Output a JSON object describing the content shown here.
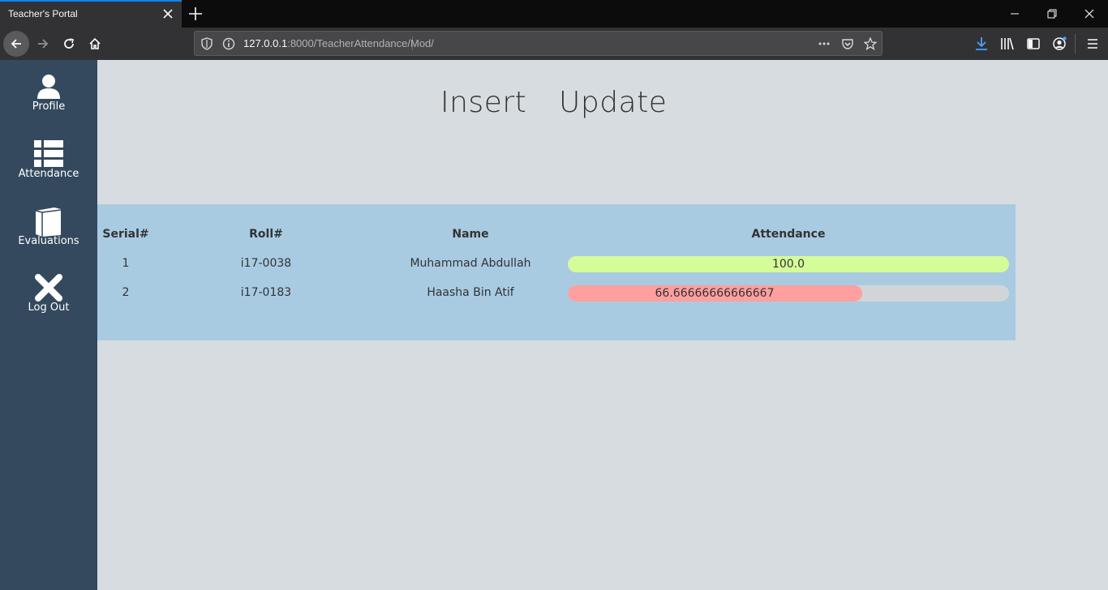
{
  "browser": {
    "tab_title": "Teacher's Portal",
    "url_host": "127.0.0.1",
    "url_rest": ":8000/TeacherAttendance/Mod/",
    "accent_color": "#0a84ff",
    "icons": [
      "close-icon",
      "plus-icon",
      "minimize-icon",
      "restore-icon",
      "back-arrow-icon",
      "forward-arrow-icon",
      "reload-icon",
      "home-icon",
      "shield-icon",
      "info-icon",
      "more-icon",
      "pocket-icon",
      "star-icon",
      "download-icon",
      "library-icon",
      "sidebar-icon",
      "account-icon",
      "menu-icon"
    ]
  },
  "sidebar": {
    "bg_color": "#34495e",
    "items": [
      {
        "label": "Profile",
        "icon": "user-icon"
      },
      {
        "label": "Attendance",
        "icon": "list-icon"
      },
      {
        "label": "Evaluations",
        "icon": "book-icon"
      },
      {
        "label": "Log Out",
        "icon": "x-icon"
      }
    ]
  },
  "header": {
    "insert_label": "Insert",
    "update_label": "Update"
  },
  "table": {
    "columns": [
      "Serial#",
      "Roll#",
      "Name",
      "Attendance"
    ],
    "rows": [
      {
        "serial": "1",
        "roll": "i17-0038",
        "name": "Muhammad Abdullah",
        "attendance": "100.0",
        "attendance_value": 100.0,
        "color": "#d4fc99"
      },
      {
        "serial": "2",
        "roll": "i17-0183",
        "name": "Haasha Bin Atif",
        "attendance": "66.66666666666667",
        "attendance_value": 66.66666666666667,
        "color": "#ff9f9f"
      }
    ]
  }
}
